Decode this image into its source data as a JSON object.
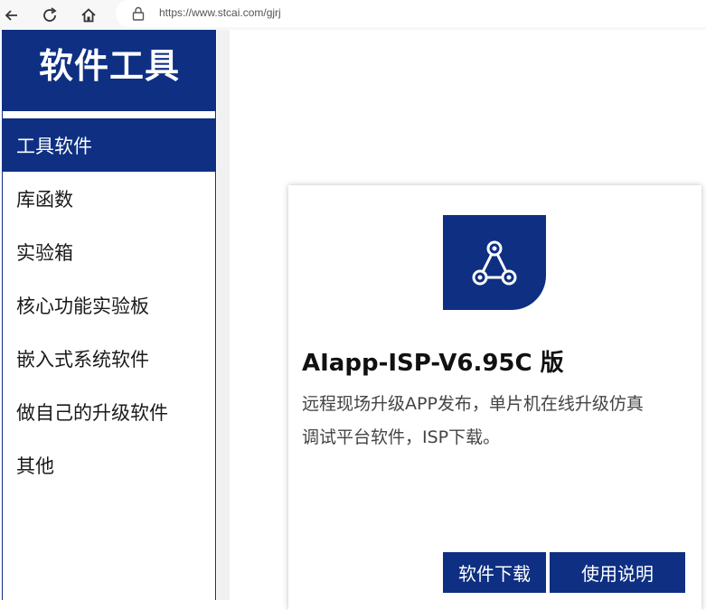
{
  "browser": {
    "url": "https://www.stcai.com/gjrj",
    "icons": [
      "back-arrow-icon",
      "reload-icon",
      "home-icon",
      "lock-icon"
    ]
  },
  "sidebar": {
    "title": "软件工具",
    "items": [
      {
        "label": "工具软件",
        "active": true
      },
      {
        "label": "库函数"
      },
      {
        "label": "实验箱"
      },
      {
        "label": "核心功能实验板"
      },
      {
        "label": "嵌入式系统软件"
      },
      {
        "label": "做自己的升级软件"
      },
      {
        "label": "其他"
      }
    ]
  },
  "card": {
    "icon": "share-network-icon",
    "title": "AIapp-ISP-V6.95C 版",
    "description_line1": "远程现场升级APP发布，单片机在线升级仿真",
    "description_line2": "调试平台软件，ISP下载。",
    "download_label": "软件下载",
    "manual_label": "使用说明"
  },
  "colors": {
    "brand": "#0e2f82",
    "text": "#444444"
  }
}
